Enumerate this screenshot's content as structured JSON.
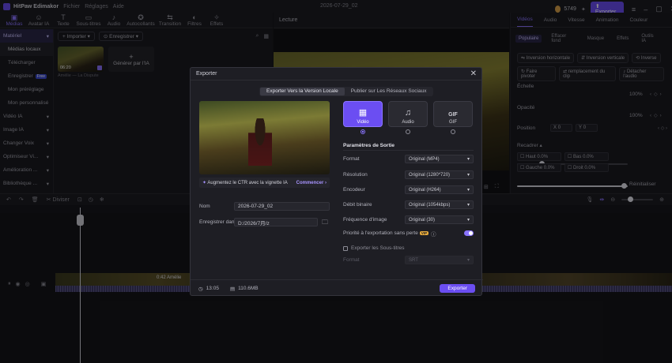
{
  "titlebar": {
    "app_name": "HitPaw Edimakor",
    "menus": [
      "Fichier",
      "Réglages",
      "Aide"
    ],
    "date": "2026-07-29_02",
    "credits": "5749",
    "export_label": "Exporter"
  },
  "toolbar": {
    "tools": [
      {
        "icon": "media-icon",
        "label": "Médias"
      },
      {
        "icon": "avatar-icon",
        "label": "Avatar IA"
      },
      {
        "icon": "text-icon",
        "label": "Texte"
      },
      {
        "icon": "subtitles-icon",
        "label": "Sous-titres"
      },
      {
        "icon": "audio-icon",
        "label": "Audio"
      },
      {
        "icon": "stickers-icon",
        "label": "Autocollants"
      },
      {
        "icon": "transition-icon",
        "label": "Transition"
      },
      {
        "icon": "filters-icon",
        "label": "Filtres"
      },
      {
        "icon": "effects-icon",
        "label": "Effets"
      }
    ]
  },
  "leftnav": {
    "group_main": "Matériel",
    "items": [
      "Médias locaux",
      "Télécharger",
      "Enregistrer",
      "Mon préréglage",
      "Mon personnalisé"
    ],
    "free_badge": "Free",
    "groups": [
      "Vidéo IA",
      "Image IA",
      "Changer Voix",
      "Optimiseur Vi...",
      "Amélioration ...",
      "Bibliothèque ..."
    ]
  },
  "media": {
    "import_label": "Importer",
    "record_label": "Enregistrer",
    "clip_duration": "06:20",
    "clip_name": "Amélie — La Dispute",
    "ai_label": "Générer par l'IA"
  },
  "preview": {
    "header": "Lecture"
  },
  "rightpanel": {
    "tabs": [
      "Vidéos",
      "Audio",
      "Vitesse",
      "Animation",
      "Couleur"
    ],
    "subtabs": [
      "Populaire",
      "Effacer fond",
      "Masque",
      "Effets",
      "Outils IA"
    ],
    "buttons_row1": [
      "Inversion horizontale",
      "Inversion verticale",
      "Inverse"
    ],
    "buttons_row2": [
      "Faire pivoter",
      "remplacement du clip",
      "Détacher l'audio"
    ],
    "scale_label": "Échelle",
    "scale_value": "100%",
    "opacity_label": "Opacité",
    "opacity_value": "100%",
    "position_label": "Position",
    "pos_x_label": "X",
    "pos_x": "0",
    "pos_y_label": "Y",
    "pos_y": "0",
    "crop_label": "Recadrer",
    "crop_fields": [
      {
        "label": "Haut",
        "value": "0.0%"
      },
      {
        "label": "Bas",
        "value": "0.0%"
      },
      {
        "label": "Gauche",
        "value": "0.0%"
      },
      {
        "label": "Droit",
        "value": "0.0%"
      }
    ],
    "reset_label": "Réinitialiser"
  },
  "timeline": {
    "split_label": "Diviser",
    "clip_label": "0:42 Amélie"
  },
  "modal": {
    "title": "Exporter",
    "tab_local": "Exporter Vers la Version Locale",
    "tab_social": "Publier sur Les Réseaux Sociaux",
    "ctr_text": "Augmentez le CTR avec la vignette IA",
    "ctr_action": "Commencer",
    "name_label": "Nom",
    "name_value": "2026-07-29_02",
    "save_label": "Enregistrer dans",
    "save_path": "D:/2026/7月/z",
    "formats": [
      {
        "icon": "video-icon",
        "label": "Vidéo",
        "glyph": "▦"
      },
      {
        "icon": "audio-icon",
        "label": "Audio",
        "glyph": "♫"
      },
      {
        "icon": "gif-icon",
        "label": "GIF",
        "glyph": "GIF"
      }
    ],
    "params_title": "Paramètres de Sortie",
    "params": [
      {
        "label": "Format",
        "value": "Original (MP4)"
      },
      {
        "label": "Résolution",
        "value": "Original (1280*720)"
      },
      {
        "label": "Encodeur",
        "value": "Original (H264)"
      },
      {
        "label": "Débit binaire",
        "value": "Original (1054kbps)"
      },
      {
        "label": "Fréquence d'image",
        "value": "Original (30)"
      }
    ],
    "lossless_label": "Priorité à l'exportation sans perte",
    "vip_badge": "VIP",
    "subs_label": "Exporter les Sous-titres",
    "subs_format_label": "Format",
    "subs_format_value": "SRT",
    "duration": "13:05",
    "filesize": "110.6MB",
    "export_label": "Exporter"
  }
}
